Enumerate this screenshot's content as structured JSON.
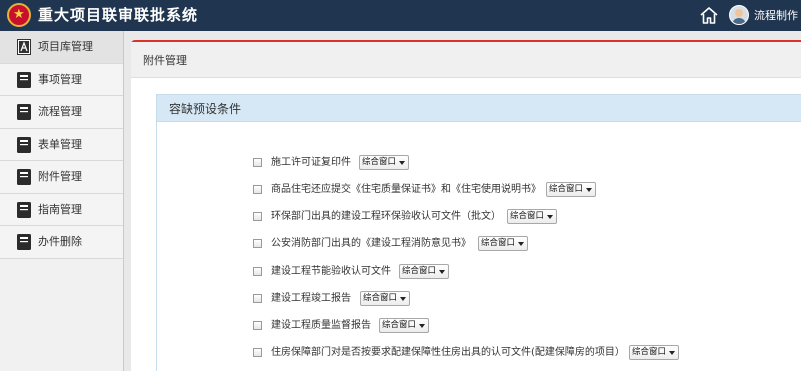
{
  "header": {
    "title": "重大项目联审联批系统",
    "user_action": "流程制作",
    "icons": [
      "emblem-icon",
      "home-icon",
      "user-avatar-icon"
    ]
  },
  "sidebar": {
    "items": [
      {
        "label": "项目库管理",
        "icon": "project-library-icon"
      },
      {
        "label": "事项管理",
        "icon": "book-icon"
      },
      {
        "label": "流程管理",
        "icon": "book-icon"
      },
      {
        "label": "表单管理",
        "icon": "book-icon"
      },
      {
        "label": "附件管理",
        "icon": "book-icon"
      },
      {
        "label": "指南管理",
        "icon": "book-icon"
      },
      {
        "label": "办件删除",
        "icon": "book-icon"
      }
    ]
  },
  "main": {
    "panel_title": "附件管理",
    "section_title": "容缺预设条件",
    "conditions": [
      {
        "label": "施工许可证复印件",
        "select_value": "综合窗口"
      },
      {
        "label": "商品住宅还应提交《住宅质量保证书》和《住宅使用说明书》",
        "select_value": "综合窗口"
      },
      {
        "label": "环保部门出具的建设工程环保验收认可文件（批文）",
        "select_value": "综合窗口"
      },
      {
        "label": "公安消防部门出具的《建设工程消防意见书》",
        "select_value": "综合窗口"
      },
      {
        "label": "建设工程节能验收认可文件",
        "select_value": "综合窗口"
      },
      {
        "label": "建设工程竣工报告",
        "select_value": "综合窗口"
      },
      {
        "label": "建设工程质量监督报告",
        "select_value": "综合窗口"
      },
      {
        "label": "住房保障部门对是否按要求配建保障性住房出具的认可文件(配建保障房的项目）",
        "select_value": "综合窗口"
      }
    ]
  },
  "colors": {
    "topbar": "#1f3550",
    "accent_red": "#d9342b",
    "section_head": "#d6e8f5"
  }
}
